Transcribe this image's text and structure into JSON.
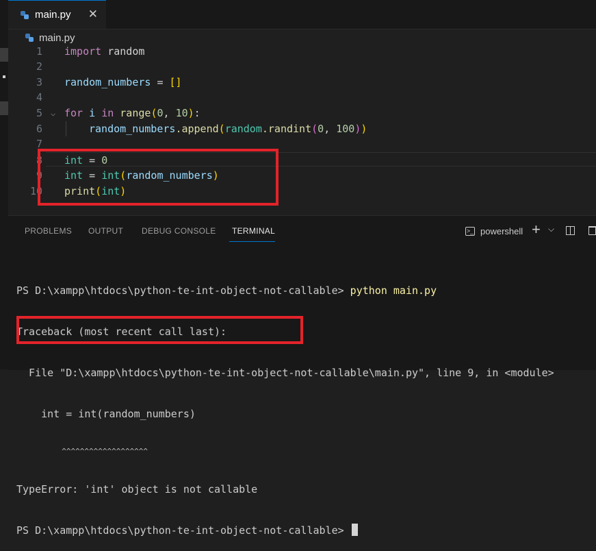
{
  "tab": {
    "label": "main.py",
    "close": "✕"
  },
  "breadcrumb": {
    "file": "main.py"
  },
  "editor": {
    "line_numbers": [
      "1",
      "2",
      "3",
      "4",
      "5",
      "6",
      "7",
      "8",
      "9",
      "10"
    ],
    "l1": {
      "kw": "import",
      "rest": " random"
    },
    "l3": {
      "var": "random_numbers",
      "op": " = ",
      "br": "[]"
    },
    "l5": {
      "kw1": "for",
      "v": " i ",
      "kw2": "in",
      "sp": " ",
      "fn": "range",
      "o": "(",
      "n1": "0",
      "c": ", ",
      "n2": "10",
      "cl": ")",
      "colon": ":"
    },
    "l6": {
      "obj": "random_numbers",
      "m": ".append",
      "o": "(",
      "mod": "random",
      "m2": ".randint",
      "o2": "(",
      "n1": "0",
      "c": ", ",
      "n2": "100",
      "cl2": ")",
      "cl": ")"
    },
    "l8": {
      "cls": "int",
      "op": " = ",
      "num": "0"
    },
    "l9": {
      "cls1": "int",
      "op": " = ",
      "cls2": "int",
      "o": "(",
      "arg": "random_numbers",
      "cl": ")"
    },
    "l10": {
      "fn": "print",
      "o": "(",
      "cls": "int",
      "cl": ")"
    }
  },
  "panel": {
    "tabs": [
      "PROBLEMS",
      "OUTPUT",
      "DEBUG CONSOLE",
      "TERMINAL"
    ],
    "active_tab": "TERMINAL",
    "shell": "powershell",
    "add": "+",
    "dropdown": "⌵"
  },
  "terminal": {
    "prompt1": "PS D:\\xampp\\htdocs\\python-te-int-object-not-callable> ",
    "cmd": "python main.py",
    "traceback": "Traceback (most recent call last):",
    "file_line": "  File \"D:\\xampp\\htdocs\\python-te-int-object-not-callable\\main.py\", line 9, in <module>",
    "code_line": "    int = int(random_numbers)",
    "carets": "          ^^^^^^^^^^^^^^^^^^^",
    "error": "TypeError: 'int' object is not callable",
    "prompt2": "PS D:\\xampp\\htdocs\\python-te-int-object-not-callable> "
  }
}
